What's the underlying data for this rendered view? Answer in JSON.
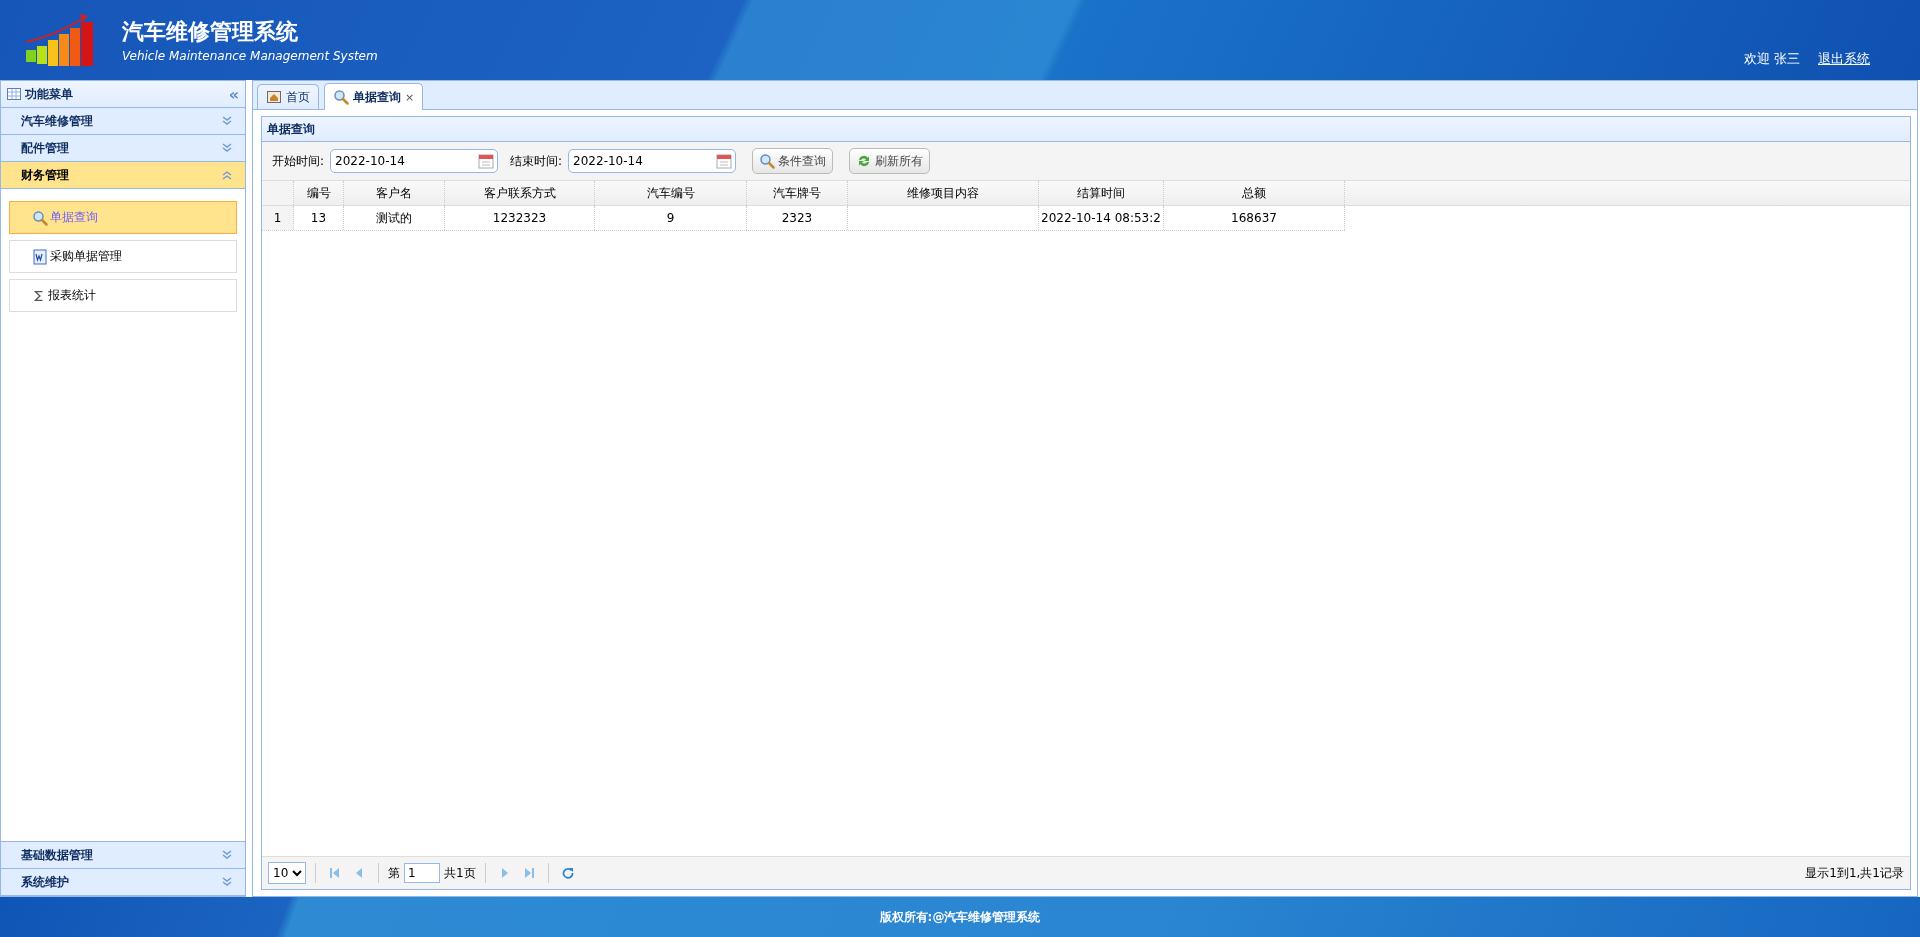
{
  "header": {
    "title": "汽车维修管理系统",
    "subtitle": "Vehicle Maintenance Management System",
    "welcome": "欢迎 张三",
    "logout": "退出系统"
  },
  "sidebar": {
    "title": "功能菜单",
    "collapse": "«",
    "sections": [
      {
        "label": "汽车维修管理",
        "expanded": false
      },
      {
        "label": "配件管理",
        "expanded": false
      },
      {
        "label": "财务管理",
        "expanded": true,
        "items": [
          {
            "label": "单据查询",
            "selected": true
          },
          {
            "label": "采购单据管理",
            "selected": false
          },
          {
            "label": "报表统计",
            "selected": false
          }
        ]
      },
      {
        "label": "基础数据管理",
        "expanded": false
      },
      {
        "label": "系统维护",
        "expanded": false
      }
    ]
  },
  "tabs": [
    {
      "label": "首页",
      "selected": false
    },
    {
      "label": "单据查询",
      "selected": true,
      "close": "×"
    }
  ],
  "panel": {
    "title": "单据查询",
    "filters": [
      {
        "label": "开始时间:",
        "value": "2022-10-14"
      },
      {
        "label": "结束时间:",
        "value": "2022-10-14"
      }
    ],
    "buttons": [
      {
        "label": "条件查询"
      },
      {
        "label": "刷新所有"
      }
    ],
    "table": {
      "columns": [
        "编号",
        "客户名",
        "客户联系方式",
        "汽车编号",
        "汽车牌号",
        "维修项目内容",
        "结算时间",
        "总额"
      ],
      "rows": [
        {
          "row_number": "1",
          "cells": [
            "13",
            "测试的",
            "1232323",
            "9",
            "2323",
            "",
            "2022-10-14 08:53:2",
            "168637"
          ]
        }
      ]
    },
    "pagination": {
      "page_size": "10",
      "page_prefix": "第",
      "page": "1",
      "page_total": "共1页",
      "summary": "显示1到1,共1记录"
    }
  },
  "footer": {
    "text": "版权所有:@汽车维修管理系统"
  }
}
